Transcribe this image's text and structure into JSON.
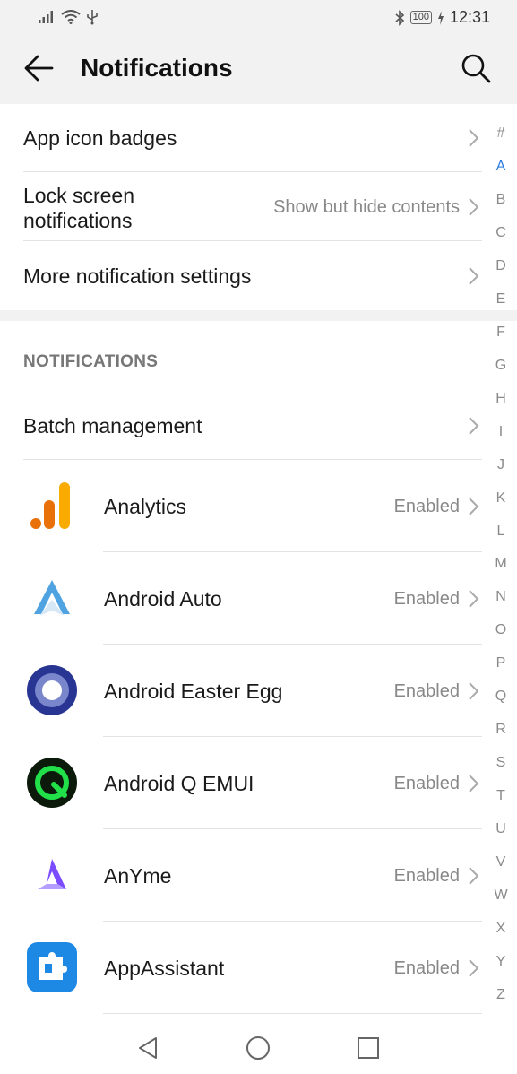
{
  "status_bar": {
    "battery": "100",
    "time": "12:31"
  },
  "header": {
    "title": "Notifications"
  },
  "settings": [
    {
      "label": "App icon badges",
      "value": ""
    },
    {
      "label": "Lock screen\nnotifications",
      "value": "Show but hide contents"
    },
    {
      "label": "More notification settings",
      "value": ""
    }
  ],
  "section": {
    "title": "NOTIFICATIONS",
    "batch_label": "Batch management"
  },
  "apps": [
    {
      "name": "Analytics",
      "status": "Enabled",
      "icon": "analytics-icon"
    },
    {
      "name": "Android Auto",
      "status": "Enabled",
      "icon": "android-auto-icon"
    },
    {
      "name": "Android Easter Egg",
      "status": "Enabled",
      "icon": "easter-egg-icon"
    },
    {
      "name": "Android Q EMUI",
      "status": "Enabled",
      "icon": "android-q-icon"
    },
    {
      "name": "AnYme",
      "status": "Enabled",
      "icon": "anyme-icon"
    },
    {
      "name": "AppAssistant",
      "status": "Enabled",
      "icon": "puzzle-icon"
    }
  ],
  "alphabet": [
    "#",
    "A",
    "B",
    "C",
    "D",
    "E",
    "F",
    "G",
    "H",
    "I",
    "J",
    "K",
    "L",
    "M",
    "N",
    "O",
    "P",
    "Q",
    "R",
    "S",
    "T",
    "U",
    "V",
    "W",
    "X",
    "Y",
    "Z"
  ],
  "alphabet_active": "A",
  "colors": {
    "accent": "#2a7de1",
    "header_bg": "#f2f2f2",
    "secondary_text": "#888888"
  }
}
